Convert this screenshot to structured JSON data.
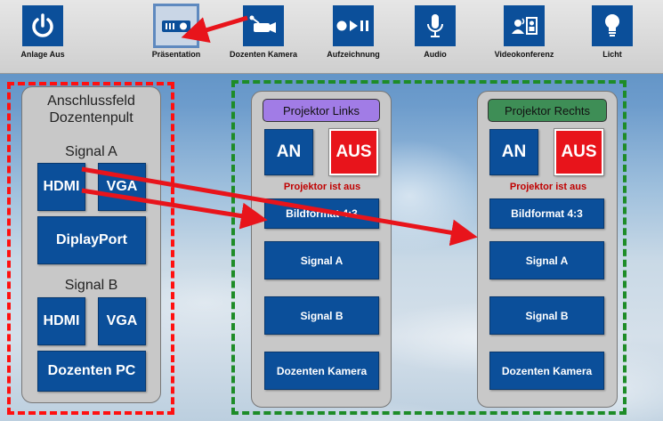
{
  "toolbar": {
    "items": [
      {
        "label": "Anlage Aus",
        "icon": "power-icon"
      },
      {
        "label": "Präsentation",
        "icon": "projector-icon",
        "active": true
      },
      {
        "label": "Dozenten Kamera",
        "icon": "camera-icon"
      },
      {
        "label": "Aufzeichnung",
        "icon": "record-icon"
      },
      {
        "label": "Audio",
        "icon": "microphone-icon"
      },
      {
        "label": "Videokonferenz",
        "icon": "videoconference-icon"
      },
      {
        "label": "Licht",
        "icon": "lightbulb-icon"
      }
    ]
  },
  "connection_panel": {
    "title_line1": "Anschlussfeld",
    "title_line2": "Dozentenpult",
    "signal_a_label": "Signal A",
    "signal_a_hdmi": "HDMI",
    "signal_a_vga": "VGA",
    "displayport": "DiplayPort",
    "signal_b_label": "Signal B",
    "signal_b_hdmi": "HDMI",
    "signal_b_vga": "VGA",
    "dozenten_pc": "Dozenten PC"
  },
  "projector_left": {
    "header": "Projektor Links",
    "header_color": "#a17ce6",
    "on_label": "AN",
    "off_label": "AUS",
    "status": "Projektor ist aus",
    "format": "Bildformat 4:3",
    "signal_a": "Signal A",
    "signal_b": "Signal B",
    "camera": "Dozenten Kamera"
  },
  "projector_right": {
    "header": "Projektor Rechts",
    "header_color": "#3e8e56",
    "on_label": "AN",
    "off_label": "AUS",
    "status": "Projektor ist aus",
    "format": "Bildformat 4:3",
    "signal_a": "Signal A",
    "signal_b": "Signal B",
    "camera": "Dozenten Kamera"
  },
  "colors": {
    "button_blue": "#0b4f9a",
    "off_red": "#e8141b",
    "status_red": "#c00000",
    "annotation_red": "#ff1010",
    "annotation_green": "#1e8c28",
    "arrow_red": "#e8141b"
  }
}
